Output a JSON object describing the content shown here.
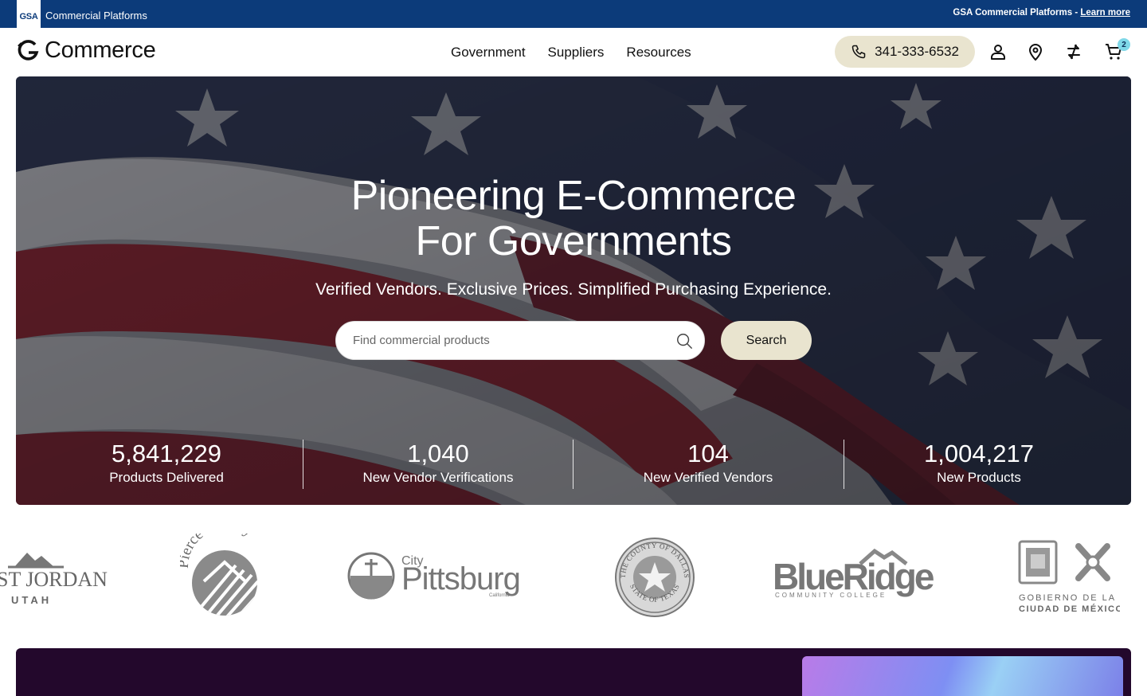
{
  "topbar": {
    "gsa_logo": "GSA",
    "platform_name": "Commercial Platforms",
    "notice_text": "GSA Commercial Platforms - ",
    "learn_more": "Learn more"
  },
  "header": {
    "brand": "Commerce",
    "nav": [
      {
        "label": "Government"
      },
      {
        "label": "Suppliers"
      },
      {
        "label": "Resources"
      }
    ],
    "phone": "341-333-6532",
    "cart_count": "2",
    "icons": [
      "user-icon",
      "location-pin-icon",
      "exchange-icon",
      "cart-icon"
    ]
  },
  "hero": {
    "title_line1": "Pioneering E-Commerce",
    "title_line2": "For Governments",
    "subtitle": "Verified Vendors. Exclusive Prices. Simplified Purchasing Experience.",
    "search_placeholder": "Find commercial products",
    "search_button": "Search",
    "stats": [
      {
        "value": "5,841,229",
        "label": "Products Delivered"
      },
      {
        "value": "1,040",
        "label": "New Vendor Verifications"
      },
      {
        "value": "104",
        "label": "New Verified Vendors"
      },
      {
        "value": "1,004,217",
        "label": "New Products"
      }
    ]
  },
  "logos": {
    "west_jordan": {
      "line1": "ST JORDAN",
      "line2": "UTAH"
    },
    "pierce_county": {
      "text": "Pierce County"
    },
    "pittsburg": {
      "city": "City",
      "name": "Pittsburg",
      "state": "California"
    },
    "dallas": {
      "top": "THE COUNTY OF DALLAS",
      "bottom": "STATE OF TEXAS"
    },
    "blueridge": {
      "name": "BlueRidge",
      "sub": "COMMUNITY COLLEGE"
    },
    "cdmx": {
      "line1": "GOBIERNO DE LA",
      "line2": "CIUDAD DE MÉXICO"
    }
  },
  "colors": {
    "gsa_blue": "#0c3b7a",
    "pill_beige": "#e9e4cf",
    "banner_dark": "#23082c"
  }
}
